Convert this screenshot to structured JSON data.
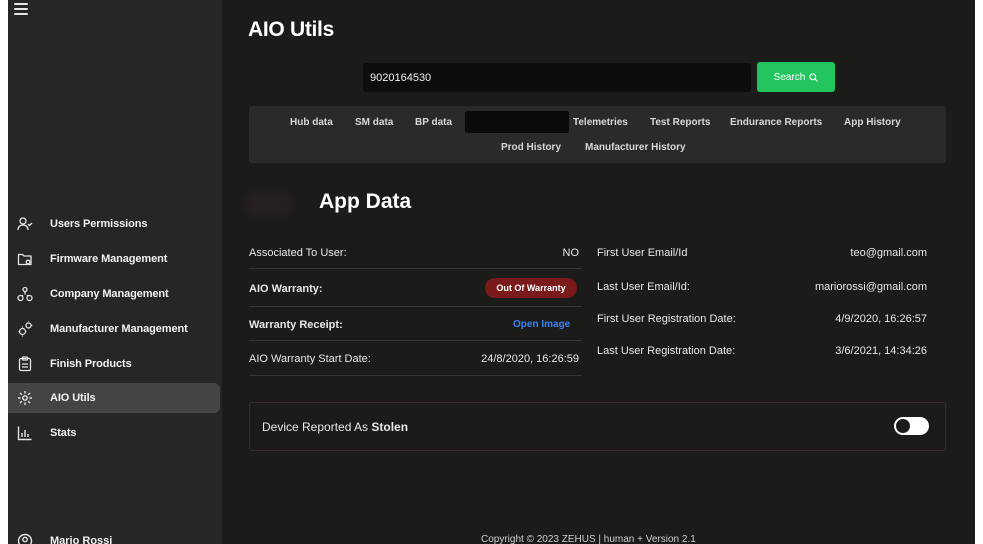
{
  "app": {
    "title": "AIO Utils"
  },
  "search": {
    "value": "9020164530",
    "button_label": "Search"
  },
  "tabs": [
    {
      "label": "Hub data"
    },
    {
      "label": "SM data"
    },
    {
      "label": "BP data"
    },
    {
      "label": ""
    },
    {
      "label": "Telemetries"
    },
    {
      "label": "Test Reports"
    },
    {
      "label": "Endurance Reports"
    },
    {
      "label": "App History"
    },
    {
      "label": "Prod History"
    },
    {
      "label": "Manufacturer History"
    }
  ],
  "sidebar": {
    "items": [
      {
        "label": "Users Permissions",
        "icon": "user-check-icon"
      },
      {
        "label": "Firmware Management",
        "icon": "folder-settings-icon"
      },
      {
        "label": "Company Management",
        "icon": "company-network-icon"
      },
      {
        "label": "Manufacturer Management",
        "icon": "gears-icon"
      },
      {
        "label": "Finish Products",
        "icon": "clipboard-icon"
      },
      {
        "label": "AIO Utils",
        "icon": "gear-icon"
      },
      {
        "label": "Stats",
        "icon": "bar-chart-icon"
      }
    ],
    "active": "AIO Utils",
    "user": {
      "name": "Mario Rossi",
      "icon": "user-circle-icon"
    }
  },
  "app_data": {
    "title": "App Data",
    "left": [
      {
        "label": "Associated To User:",
        "value": "NO"
      },
      {
        "label": "AIO Warranty:",
        "value": "Out Of Warranty"
      },
      {
        "label": "Warranty Receipt:",
        "value": "Open Image"
      },
      {
        "label": "AIO Warranty Start Date:",
        "value": "24/8/2020, 16:26:59"
      }
    ],
    "right": [
      {
        "label": "First User Email/Id",
        "value": "teo@gmail.com"
      },
      {
        "label": "Last User Email/Id:",
        "value": "mariorossi@gmail.com"
      },
      {
        "label": "First User Registration Date:",
        "value": "4/9/2020, 16:26:57"
      },
      {
        "label": "Last User Registration Date:",
        "value": "3/6/2021, 14:34:26"
      }
    ]
  },
  "stolen": {
    "prefix": "Device Reported As ",
    "emphasis": "Stolen",
    "enabled": false
  },
  "footer": {
    "text": "Copyright © 2023 ZEHUS | human + Version 2.1"
  },
  "colors": {
    "accent": "#22c55e",
    "danger": "#7a1a1a",
    "link": "#3b82f6",
    "background": "#1b1b1a",
    "sidebar": "#262625"
  }
}
